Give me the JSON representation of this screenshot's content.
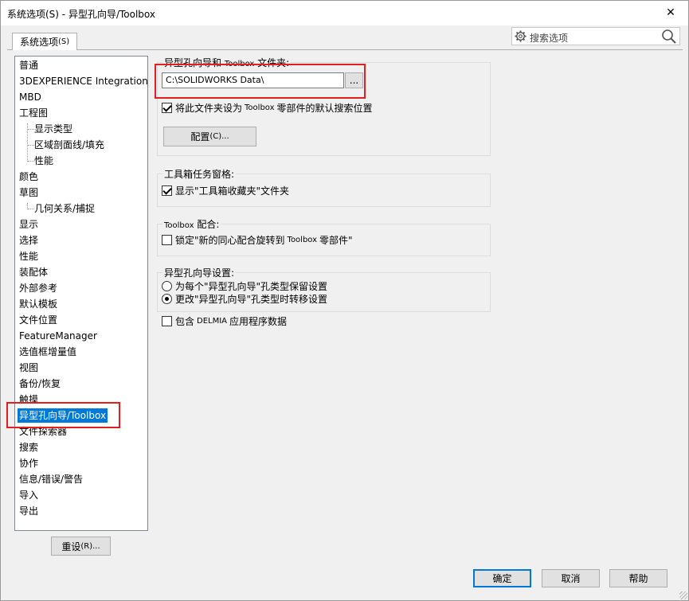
{
  "window": {
    "title": "系统选项(S) - 异型孔向导/Toolbox",
    "close_glyph": "✕"
  },
  "tab": {
    "label_main": "系统选项",
    "label_sub": "(S)"
  },
  "search": {
    "placeholder": "搜索选项"
  },
  "tree": {
    "items": [
      {
        "label": "普通"
      },
      {
        "label": "3DEXPERIENCE Integration"
      },
      {
        "label": "MBD"
      },
      {
        "label": "工程图"
      },
      {
        "label": "显示类型"
      },
      {
        "label": "区域剖面线/填充"
      },
      {
        "label": "性能"
      },
      {
        "label": "颜色"
      },
      {
        "label": "草图"
      },
      {
        "label": "几何关系/捕捉"
      },
      {
        "label": "显示"
      },
      {
        "label": "选择"
      },
      {
        "label": "性能"
      },
      {
        "label": "装配体"
      },
      {
        "label": "外部参考"
      },
      {
        "label": "默认模板"
      },
      {
        "label": "文件位置"
      },
      {
        "label": "FeatureManager"
      },
      {
        "label": "选值框增量值"
      },
      {
        "label": "视图"
      },
      {
        "label": "备份/恢复"
      },
      {
        "label": "触摸"
      },
      {
        "label": "异型孔向导/Toolbox"
      },
      {
        "label": "文件探索器"
      },
      {
        "label": "搜索"
      },
      {
        "label": "协作"
      },
      {
        "label": "信息/错误/警告"
      },
      {
        "label": "导入"
      },
      {
        "label": "导出"
      }
    ],
    "selected": "异型孔向导/Toolbox"
  },
  "folder_group": {
    "title_a": "异型孔向导和",
    "title_b": "Toolbox",
    "title_c": "文件夹:",
    "path_value": "C:\\SOLIDWORKS Data\\",
    "browse_label": "...",
    "default_search_a": "将此文件夹设为",
    "default_search_b": "Toolbox",
    "default_search_c": "零部件的默认搜索位置",
    "default_search_checked": true,
    "config_main": "配置",
    "config_sub": "(C)..."
  },
  "taskpane_group": {
    "title": "工具箱任务窗格:",
    "show_folder_label": "显示\"工具箱收藏夹\"文件夹",
    "show_folder_checked": true
  },
  "mates_group": {
    "title_a": "Toolbox",
    "title_b": "配合:",
    "lock_a": "锁定\"新的同心配合旋转到",
    "lock_b": "Toolbox",
    "lock_c": "零部件\"",
    "lock_checked": false
  },
  "hole_group": {
    "title": "异型孔向导设置:",
    "opt1": "为每个\"异型孔向导\"孔类型保留设置",
    "opt2": "更改\"异型孔向导\"孔类型时转移设置",
    "selected_option": 2
  },
  "delmia": {
    "label_a": "包含",
    "label_b": "DELMIA",
    "label_c": "应用程序数据",
    "checked": false
  },
  "buttons": {
    "reset_main": "重设",
    "reset_sub": "(R)...",
    "ok": "确定",
    "cancel": "取消",
    "help": "帮助"
  },
  "colors": {
    "selection": "#0078d7",
    "highlight": "#e02020"
  }
}
